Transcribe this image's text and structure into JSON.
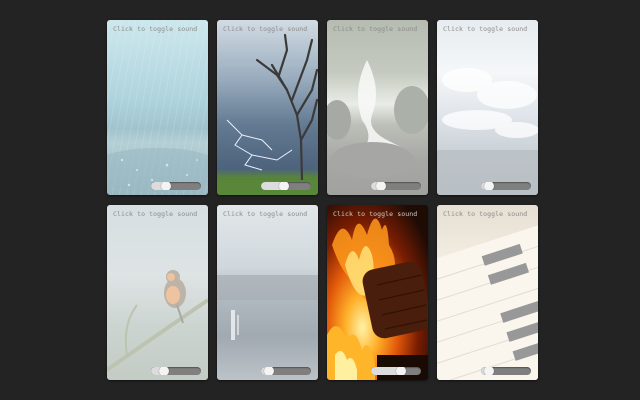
{
  "cards": [
    {
      "id": "rain",
      "hint": "Click to toggle sound",
      "scene_icon": "rain-icon",
      "active": false,
      "volume": 0.3
    },
    {
      "id": "thunder",
      "hint": "Click to toggle sound",
      "scene_icon": "lightning-icon",
      "active": false,
      "volume": 0.45
    },
    {
      "id": "stream",
      "hint": "Click to toggle sound",
      "scene_icon": "stream-icon",
      "active": false,
      "volume": 0.2
    },
    {
      "id": "waves",
      "hint": "Click to toggle sound",
      "scene_icon": "waves-icon",
      "active": false,
      "volume": 0.15
    },
    {
      "id": "birds",
      "hint": "Click to toggle sound",
      "scene_icon": "bird-icon",
      "active": false,
      "volume": 0.25
    },
    {
      "id": "lake",
      "hint": "Click to toggle sound",
      "scene_icon": "lake-icon",
      "active": false,
      "volume": 0.15
    },
    {
      "id": "fire",
      "hint": "Click to toggle sound",
      "scene_icon": "fire-icon",
      "active": true,
      "volume": 0.6
    },
    {
      "id": "piano",
      "hint": "Click to toggle sound",
      "scene_icon": "piano-icon",
      "active": false,
      "volume": 0.15
    }
  ],
  "colors": {
    "page_background": "#232323",
    "slider_track": "#7f7f7f",
    "slider_fill": "#dcdcdc",
    "hint_text": "#8a8a8a"
  }
}
